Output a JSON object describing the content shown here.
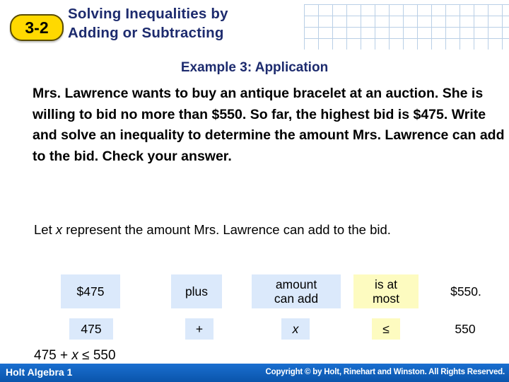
{
  "header": {
    "lesson_number": "3-2",
    "title_line1": "Solving Inequalities by",
    "title_line2": "Adding or Subtracting",
    "accent_badge_color": "#ffd900",
    "title_color": "#1d2b6e"
  },
  "example": {
    "title": "Example 3: Application",
    "problem": "Mrs. Lawrence wants to buy an antique bracelet at an auction. She is willing to bid no more than $550. So far, the highest bid is $475. Write and solve an inequality to determine the amount Mrs. Lawrence can add to the bid. Check your answer.",
    "let_statement_pre": "Let ",
    "let_statement_var": "x",
    "let_statement_post": " represent the amount Mrs. Lawrence can add to the bid."
  },
  "translation_table": {
    "phrases": [
      {
        "text": "$475",
        "bg": "#dbe9fb"
      },
      {
        "text": "plus",
        "bg": "#dbe9fb"
      },
      {
        "text": "amount\ncan add",
        "bg": "#dbe9fb"
      },
      {
        "text": "is at\nmost",
        "bg": "#fdfbc0"
      },
      {
        "text": "$550.",
        "bg": "#fdfbc0"
      }
    ],
    "symbols": [
      {
        "text": "475",
        "bg": "#dbe9fb"
      },
      {
        "text": "+",
        "bg": "#dbe9fb"
      },
      {
        "text": "x",
        "bg": "#dbe9fb",
        "italic": true
      },
      {
        "text": "≤",
        "bg": "#fdfbc0"
      },
      {
        "text": "550",
        "bg": "#fdfbc0"
      }
    ]
  },
  "final_inequality": {
    "pre": "475 + ",
    "var": "x",
    "post": " ≤ 550"
  },
  "footer": {
    "left_text": "Holt Algebra 1",
    "right_text": "Copyright © by Holt, Rinehart and Winston. All Rights Reserved.",
    "bar_color": "#0c63c4"
  }
}
